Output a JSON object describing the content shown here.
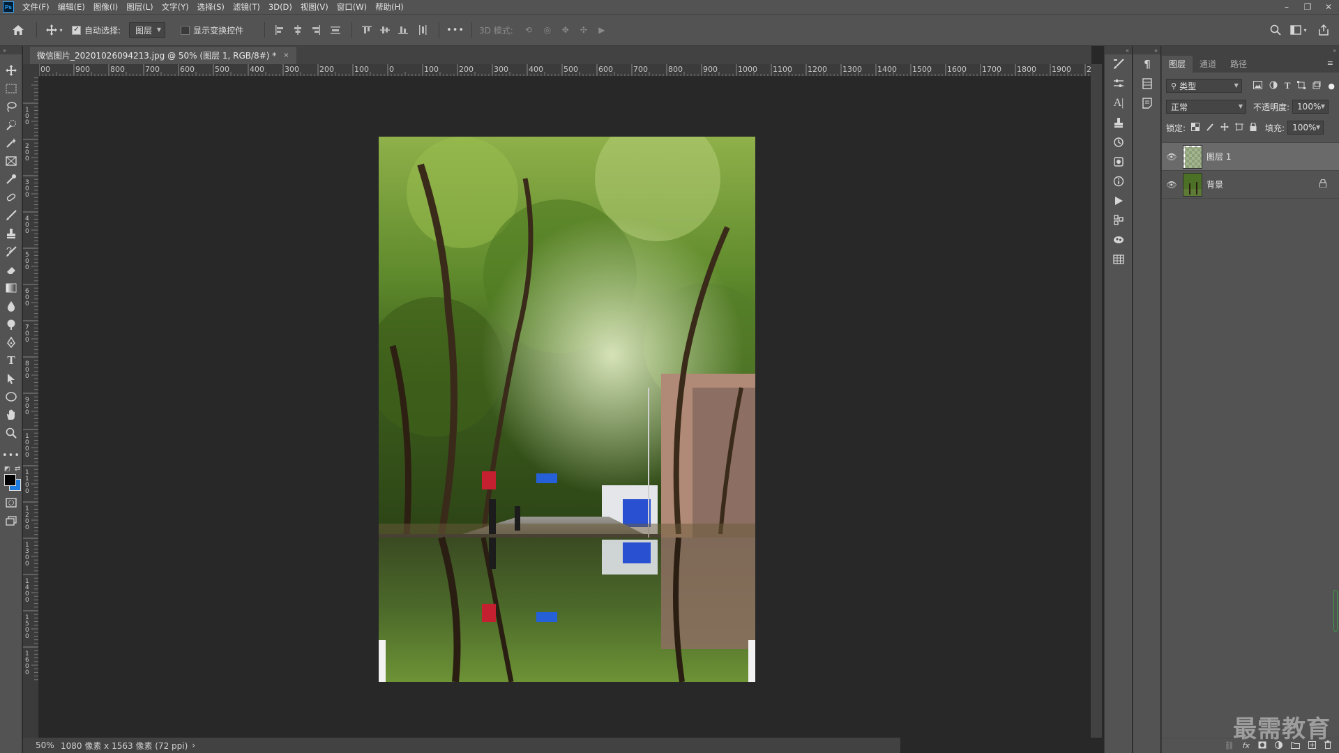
{
  "menubar": {
    "logo": "Ps",
    "items": [
      "文件(F)",
      "编辑(E)",
      "图像(I)",
      "图层(L)",
      "文字(Y)",
      "选择(S)",
      "滤镜(T)",
      "3D(D)",
      "视图(V)",
      "窗口(W)",
      "帮助(H)"
    ],
    "window_controls": [
      "minimize-icon",
      "restore-icon",
      "close-icon"
    ]
  },
  "options": {
    "auto_select_label": "自动选择:",
    "auto_select_checked": true,
    "auto_select_value": "图层",
    "show_transform_label": "显示变换控件",
    "show_transform_checked": false,
    "more": "•••",
    "mode_3d_label": "3D 模式:"
  },
  "document": {
    "tab_title": "微信图片_20201026094213.jpg @ 50% (图层 1, RGB/8#) *",
    "close": "×"
  },
  "rulers": {
    "horizontal": [
      "00",
      "900",
      "800",
      "700",
      "600",
      "500",
      "400",
      "300",
      "200",
      "100",
      "0",
      "100",
      "200",
      "300",
      "400",
      "500",
      "600",
      "700",
      "800",
      "900",
      "1000",
      "1100",
      "1200",
      "1300",
      "1400",
      "1500",
      "1600",
      "1700",
      "1800",
      "1900",
      "200"
    ],
    "vertical": [
      "0",
      "1 0 0",
      "2 0 0",
      "3 0 0",
      "4 0 0",
      "5 0 0",
      "6 0 0",
      "7 0 0",
      "8 0 0",
      "9 0 0",
      "1 0 0 0",
      "1 1 0 0",
      "1 2 0 0",
      "1 3 0 0",
      "1 4 0 0",
      "1 5 0 0",
      "1 6 0 0"
    ]
  },
  "status": {
    "zoom": "50%",
    "info": "1080 像素 x 1563 像素 (72 ppi)",
    "arrow": "›"
  },
  "layers_panel": {
    "tabs": [
      "图层",
      "通道",
      "路径"
    ],
    "active_tab": "图层",
    "filter_label": "类型",
    "blend_mode": "正常",
    "opacity_label": "不透明度:",
    "opacity_value": "100%",
    "lock_label": "锁定:",
    "fill_label": "填充:",
    "fill_value": "100%",
    "layers": [
      {
        "name": "图层 1",
        "selected": true,
        "locked": false
      },
      {
        "name": "背景",
        "selected": false,
        "locked": true
      }
    ]
  },
  "watermark": "最需教育",
  "colors": {
    "foreground": "#000000",
    "background": "#1e7be0",
    "accent": "#31a8ff"
  }
}
